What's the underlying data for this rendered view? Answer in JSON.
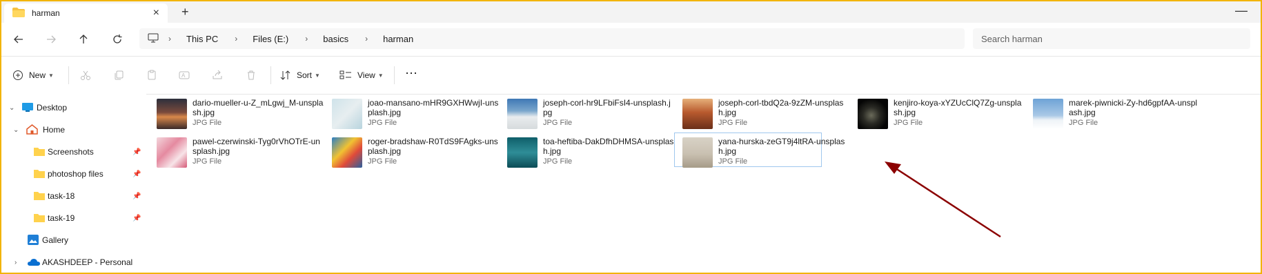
{
  "window": {
    "tab_title": "harman",
    "accent_color": "#f2b400"
  },
  "address": {
    "breadcrumbs": [
      "This PC",
      "Files (E:)",
      "basics",
      "harman"
    ],
    "search_placeholder": "Search harman"
  },
  "toolbar": {
    "new_label": "New",
    "sort_label": "Sort",
    "view_label": "View",
    "more_icon": "ellipsis-icon"
  },
  "sidebar": {
    "items": [
      {
        "label": "Desktop",
        "icon": "desktop-icon"
      },
      {
        "label": "Home",
        "icon": "home-icon"
      },
      {
        "label": "Screenshots",
        "icon": "folder-icon"
      },
      {
        "label": "photoshop files",
        "icon": "folder-icon"
      },
      {
        "label": "task-18",
        "icon": "folder-icon"
      },
      {
        "label": "task-19",
        "icon": "folder-icon"
      },
      {
        "label": "Gallery",
        "icon": "gallery-icon"
      },
      {
        "label": "AKASHDEEP - Personal",
        "icon": "cloud-icon"
      }
    ]
  },
  "files": [
    {
      "name": "dario-mueller-u-Z_mLgwj_M-unsplash.jpg",
      "type": "JPG File"
    },
    {
      "name": "joao-mansano-mHR9GXHWwjI-unsplash.jpg",
      "type": "JPG File"
    },
    {
      "name": "joseph-corl-hr9LFbiFsI4-unsplash.jpg",
      "type": "JPG File"
    },
    {
      "name": "joseph-corl-tbdQ2a-9zZM-unsplash.jpg",
      "type": "JPG File"
    },
    {
      "name": "kenjiro-koya-xYZUcClQ7Zg-unsplash.jpg",
      "type": "JPG File"
    },
    {
      "name": "marek-piwnicki-Zy-hd6gpfAA-unsplash.jpg",
      "type": "JPG File"
    },
    {
      "name": "pawel-czerwinski-Tyg0rVhOTrE-unsplash.jpg",
      "type": "JPG File"
    },
    {
      "name": "roger-bradshaw-R0TdS9FAgks-unsplash.jpg",
      "type": "JPG File"
    },
    {
      "name": "toa-heftiba-DakDfhDHMSA-unsplash.jpg",
      "type": "JPG File"
    },
    {
      "name": "yana-hurska-zeGT9j4ltRA-unsplash.jpg",
      "type": "JPG File"
    }
  ],
  "annotation": {
    "color": "#8b0000"
  }
}
